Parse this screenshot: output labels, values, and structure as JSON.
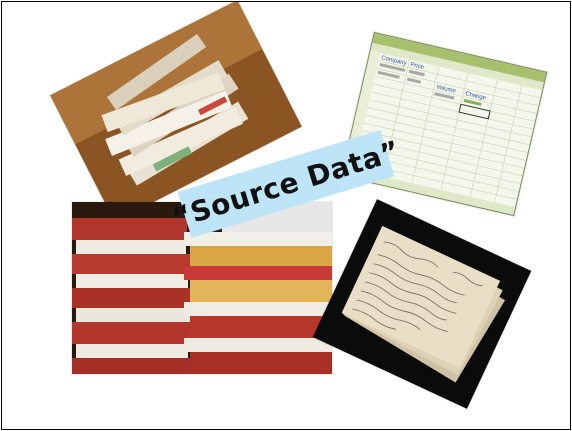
{
  "slide": {
    "label": "“Source Data”",
    "label_bg": "#bde4f7"
  },
  "images": [
    {
      "name": "envelope-stack-photo"
    },
    {
      "name": "spreadsheet-screenshot"
    },
    {
      "name": "folder-stack-photo"
    },
    {
      "name": "index-cards-photo"
    }
  ],
  "spreadsheet": {
    "headers": [
      "Company",
      "Price",
      "Volume",
      "Change"
    ]
  }
}
